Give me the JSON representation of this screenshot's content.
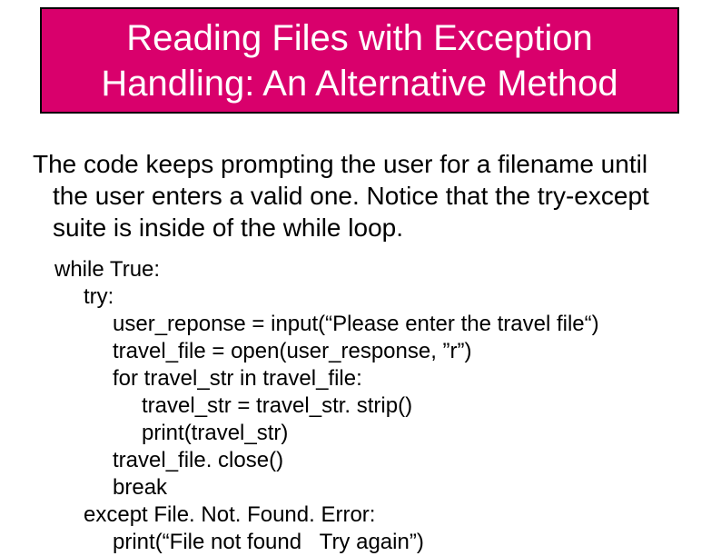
{
  "title": "Reading Files with Exception Handling: An Alternative Method",
  "body": "The code keeps prompting the user for a filename until the user enters a valid one.  Notice that the try-except suite is inside of the while loop.",
  "code": {
    "l01": "while True:",
    "l02": "try:",
    "l03": "user_reponse = input(“Please enter the travel file“)",
    "l04": "travel_file = open(user_response, ”r”)",
    "l05": "for travel_str in travel_file:",
    "l06": "travel_str = travel_str. strip()",
    "l07": "print(travel_str)",
    "l08": "travel_file. close()",
    "l09": "break",
    "l10": "except File. Not. Found. Error:",
    "l11": "print(“File not found   Try again”)"
  }
}
